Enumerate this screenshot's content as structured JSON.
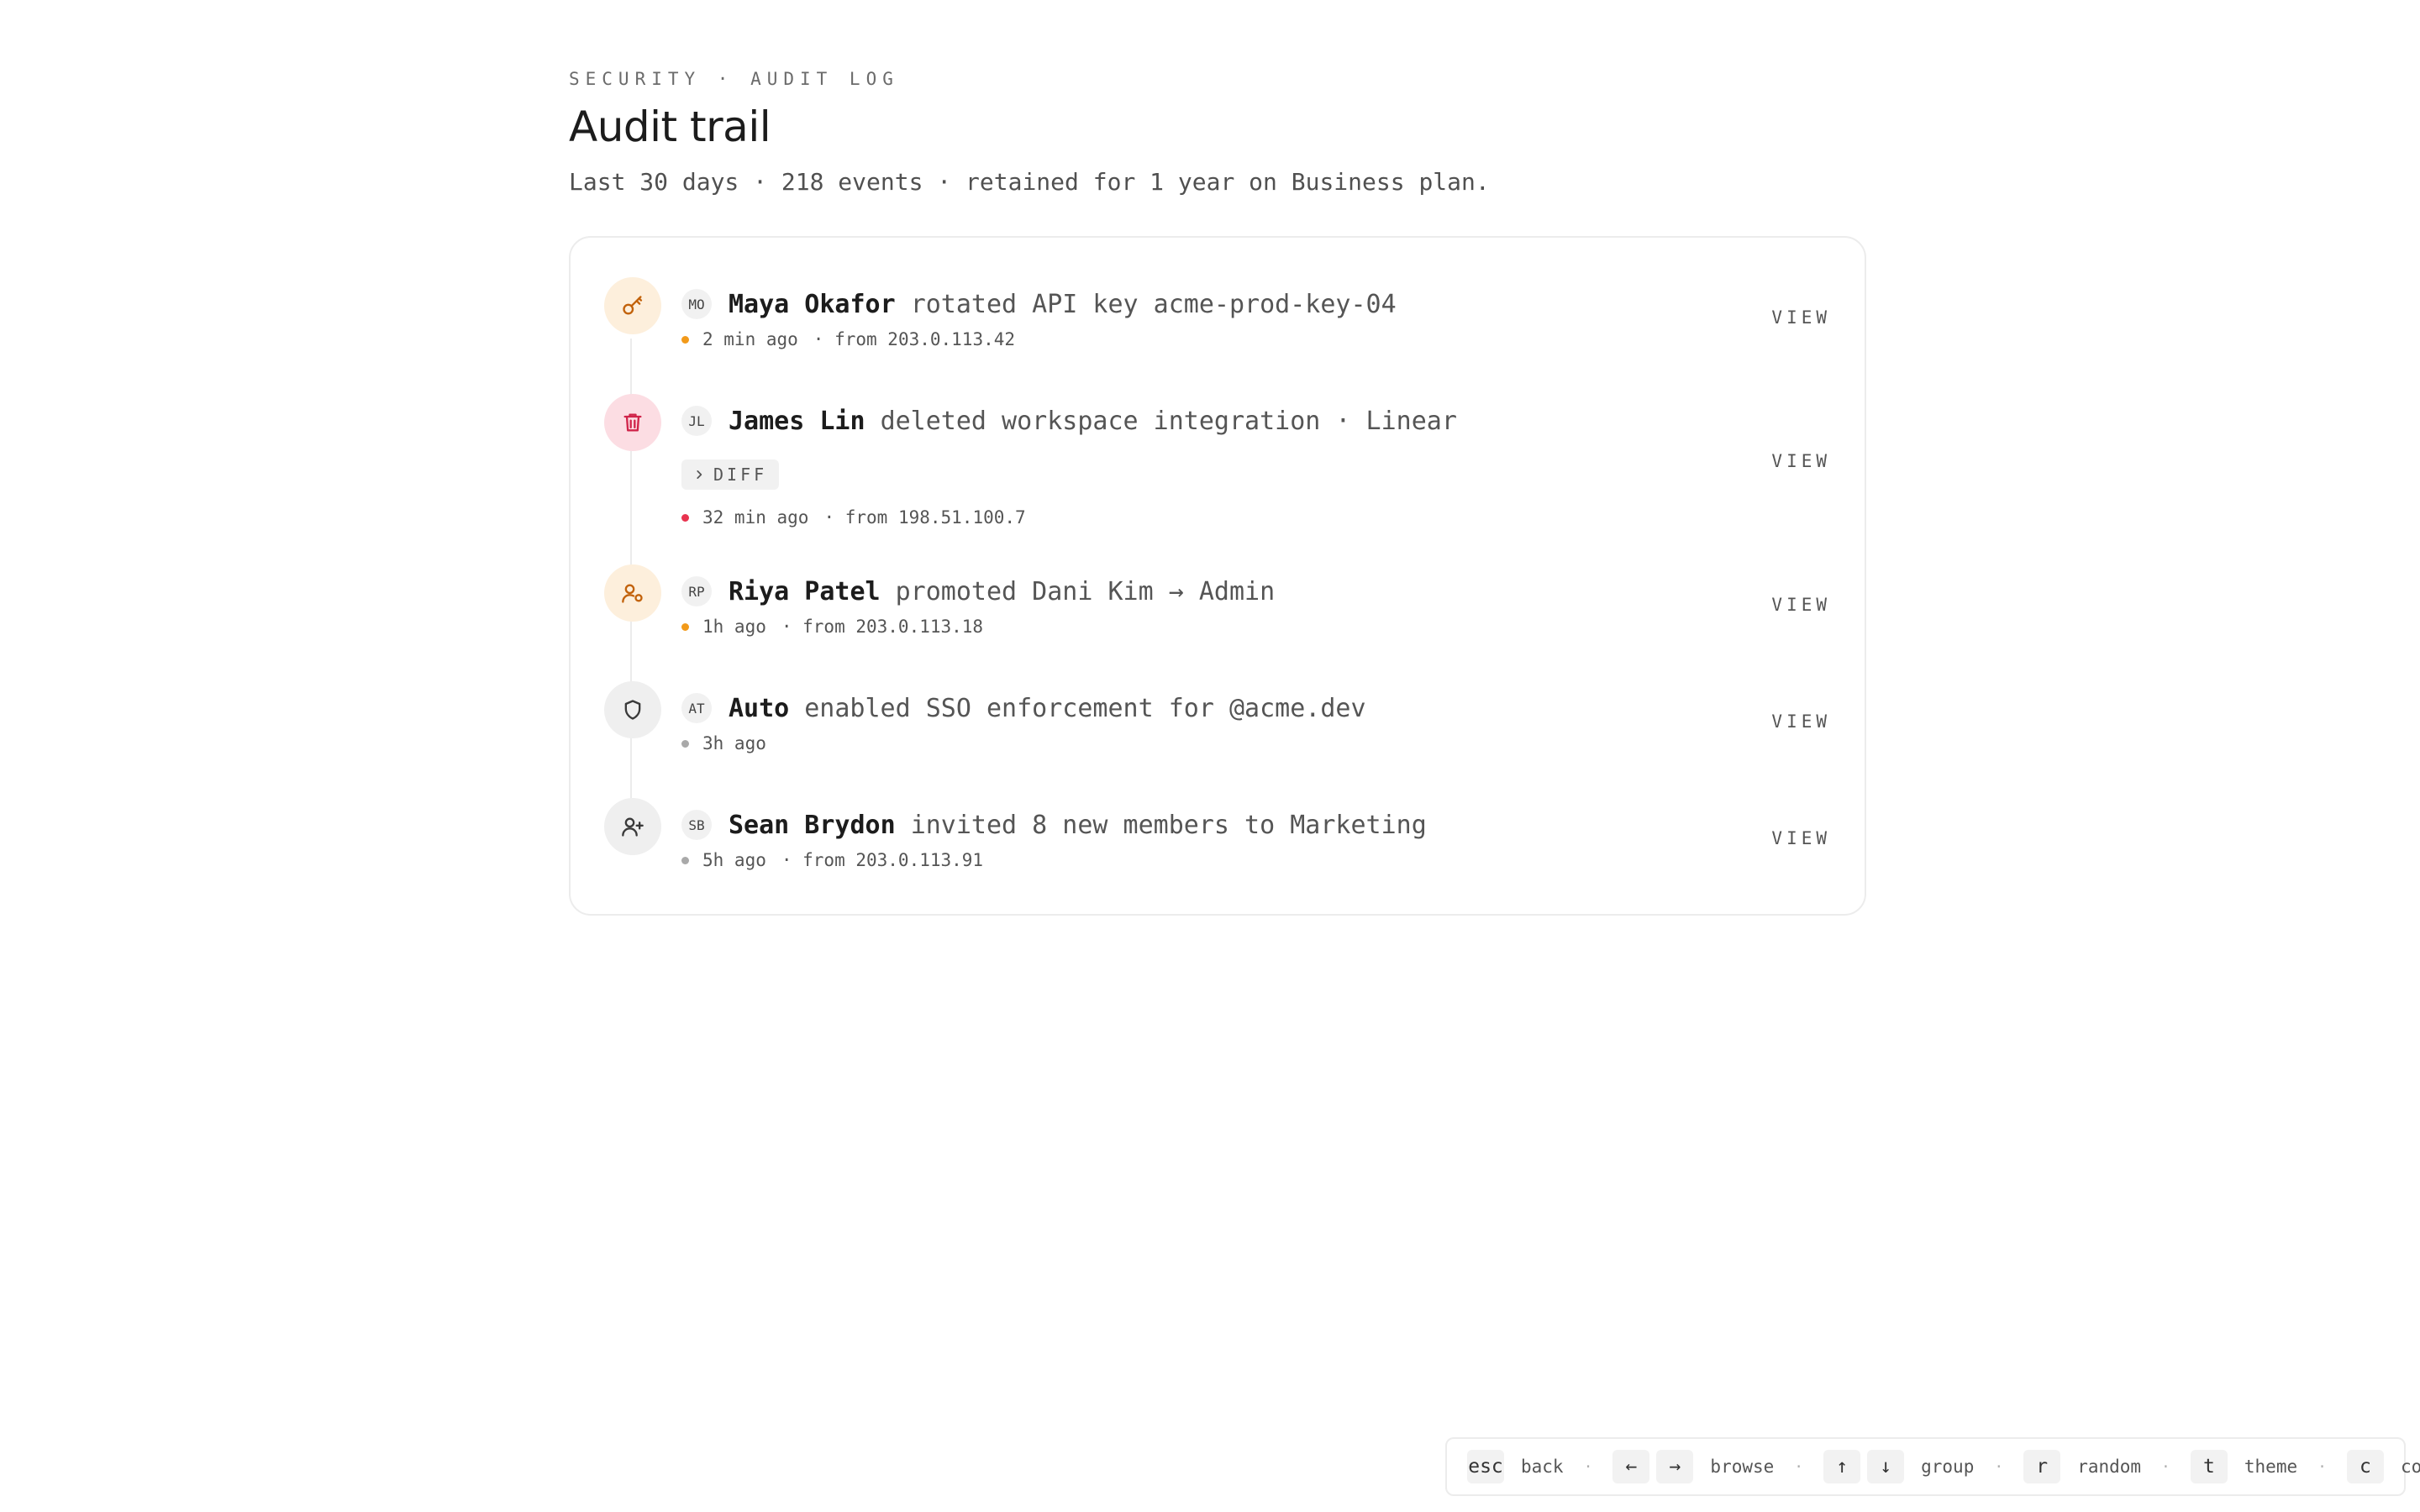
{
  "header": {
    "eyebrow": "SECURITY · AUDIT LOG",
    "title": "Audit trail",
    "subtitle": "Last 30 days · 218 events · retained for 1 year on Business plan."
  },
  "events": [
    {
      "icon": "key-icon",
      "tone": "orange",
      "initials": "MO",
      "actor": "Maya Okafor",
      "action": "rotated API key acme-prod-key-04",
      "time": "2 min ago",
      "source": "· from 203.0.113.42",
      "view_label": "VIEW"
    },
    {
      "icon": "trash-icon",
      "tone": "red",
      "initials": "JL",
      "actor": "James Lin",
      "action": "deleted workspace integration · Linear",
      "diff_label": "DIFF",
      "time": "32 min ago",
      "source": "· from 198.51.100.7",
      "view_label": "VIEW"
    },
    {
      "icon": "user-role-icon",
      "tone": "orange",
      "initials": "RP",
      "actor": "Riya Patel",
      "action": "promoted Dani Kim → Admin",
      "time": "1h ago",
      "source": "· from 203.0.113.18",
      "view_label": "VIEW"
    },
    {
      "icon": "shield-icon",
      "tone": "gray",
      "initials": "AT",
      "actor": "Auto",
      "action": "enabled SSO enforcement for @acme.dev",
      "time": "3h ago",
      "source": "",
      "view_label": "VIEW"
    },
    {
      "icon": "user-plus-icon",
      "tone": "gray",
      "initials": "SB",
      "actor": "Sean Brydon",
      "action": "invited 8 new members to Marketing",
      "time": "5h ago",
      "source": "· from 203.0.113.91",
      "view_label": "VIEW"
    }
  ],
  "shortcuts": {
    "esc_key": "esc",
    "esc_label": "back",
    "left_key": "←",
    "right_key": "→",
    "browse_label": "browse",
    "up_key": "↑",
    "down_key": "↓",
    "group_label": "group",
    "r_key": "r",
    "r_label": "random",
    "t_key": "t",
    "t_label": "theme",
    "c_key": "c",
    "c_label": "code",
    "separator": "·"
  },
  "colors": {
    "orange_badge": "#fdefdc",
    "orange_accent": "#c2620b",
    "red_badge": "#fcdde3",
    "red_accent": "#d0244a",
    "gray_badge": "#efefef"
  }
}
